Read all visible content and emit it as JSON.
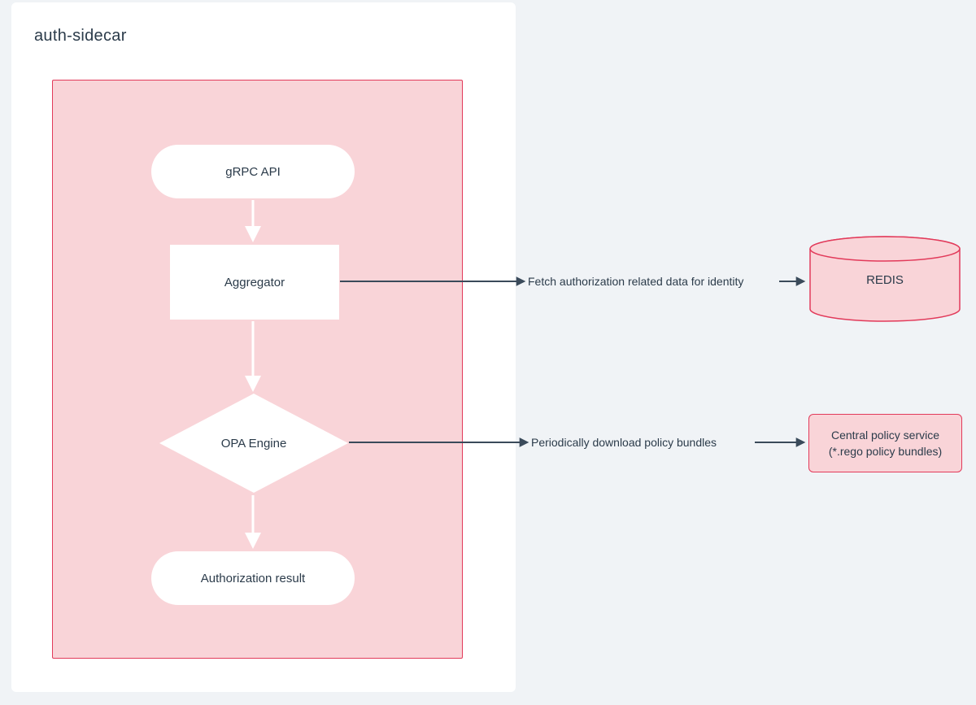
{
  "panel": {
    "title": "auth-sidecar"
  },
  "nodes": {
    "grpc_api": "gRPC API",
    "aggregator": "Aggregator",
    "opa_engine": "OPA Engine",
    "auth_result": "Authorization result",
    "redis": "REDIS",
    "policy_service_line1": "Central policy service",
    "policy_service_line2": "(*.rego policy bundles)"
  },
  "edges": {
    "fetch_data": "Fetch authorization related data for identity",
    "download_bundles": "Periodically download policy bundles"
  },
  "colors": {
    "stroke_dark": "#3a4a5a",
    "accent": "#e23a5a",
    "fill_light": "#f9d4d8"
  }
}
